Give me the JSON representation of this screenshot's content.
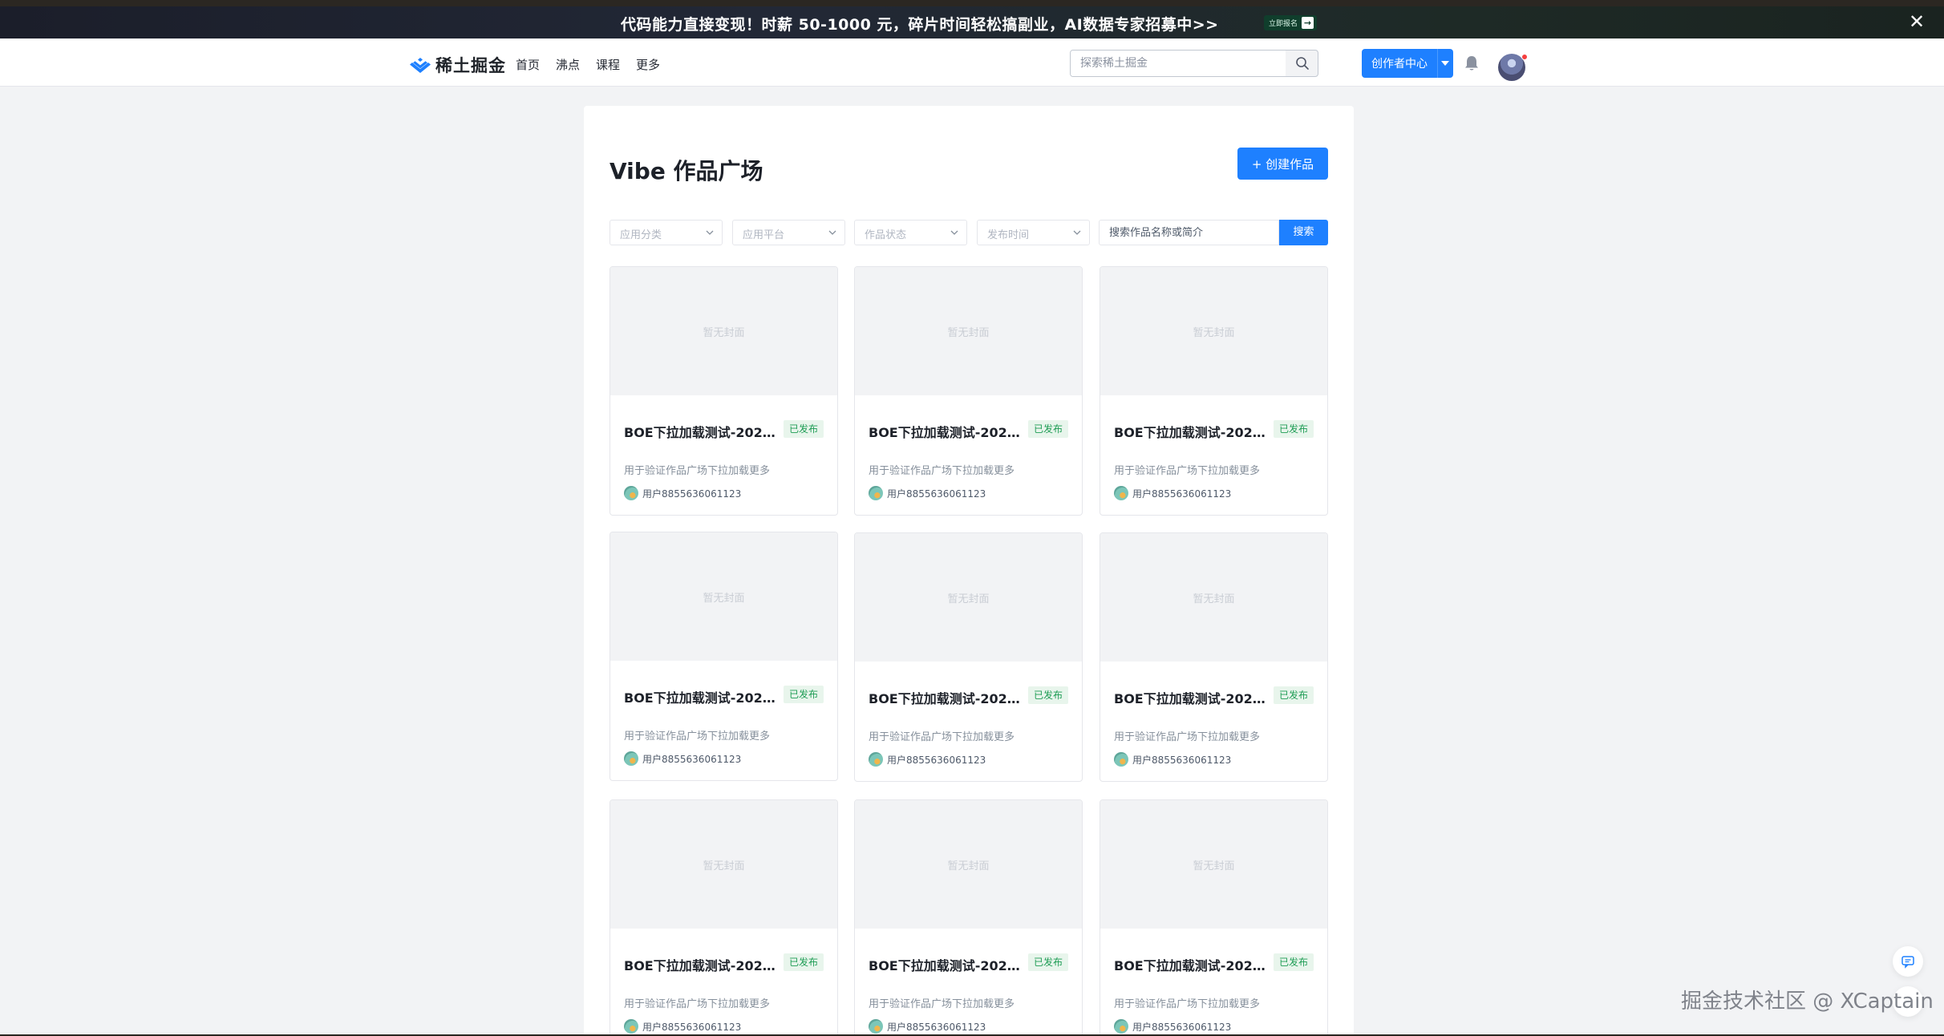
{
  "banner": {
    "text": "代码能力直接变现！时薪 50-1000 元，碎片时间轻松搞副业，AI数据专家招募中>>",
    "cta_label": "立即报名",
    "close_icon": "close-icon"
  },
  "header": {
    "logo_text": "稀土掘金",
    "nav": [
      "首页",
      "沸点",
      "课程",
      "更多"
    ],
    "search_placeholder": "探索稀土掘金",
    "creator_label": "创作者中心",
    "accent": "#1e80ff"
  },
  "main": {
    "title": "Vibe 作品广场",
    "create_label": "+ 创建作品",
    "filters": [
      "应用分类",
      "应用平台",
      "作品状态",
      "发布时间"
    ],
    "search_placeholder": "搜索作品名称或简介",
    "search_button": "搜索",
    "cards": [
      {
        "cover": "暂无封面",
        "title": "BOE下拉加载测试-2026...",
        "status": "已发布",
        "desc": "用于验证作品广场下拉加载更多",
        "author": "用户8855636061123"
      },
      {
        "cover": "暂无封面",
        "title": "BOE下拉加载测试-2026...",
        "status": "已发布",
        "desc": "用于验证作品广场下拉加载更多",
        "author": "用户8855636061123"
      },
      {
        "cover": "暂无封面",
        "title": "BOE下拉加载测试-2026...",
        "status": "已发布",
        "desc": "用于验证作品广场下拉加载更多",
        "author": "用户8855636061123"
      },
      {
        "cover": "暂无封面",
        "title": "BOE下拉加载测试-2026...",
        "status": "已发布",
        "desc": "用于验证作品广场下拉加载更多",
        "author": "用户8855636061123"
      },
      {
        "cover": "暂无封面",
        "title": "BOE下拉加载测试-2026...",
        "status": "已发布",
        "desc": "用于验证作品广场下拉加载更多",
        "author": "用户8855636061123"
      },
      {
        "cover": "暂无封面",
        "title": "BOE下拉加载测试-2026...",
        "status": "已发布",
        "desc": "用于验证作品广场下拉加载更多",
        "author": "用户8855636061123"
      },
      {
        "cover": "暂无封面",
        "title": "BOE下拉加载测试-2026...",
        "status": "已发布",
        "desc": "用于验证作品广场下拉加载更多",
        "author": "用户8855636061123"
      },
      {
        "cover": "暂无封面",
        "title": "BOE下拉加载测试-2026...",
        "status": "已发布",
        "desc": "用于验证作品广场下拉加载更多",
        "author": "用户8855636061123"
      },
      {
        "cover": "暂无封面",
        "title": "BOE下拉加载测试-2026...",
        "status": "已发布",
        "desc": "用于验证作品广场下拉加载更多",
        "author": "用户8855636061123"
      }
    ]
  },
  "watermark": "掘金技术社区 @ XCaptain"
}
